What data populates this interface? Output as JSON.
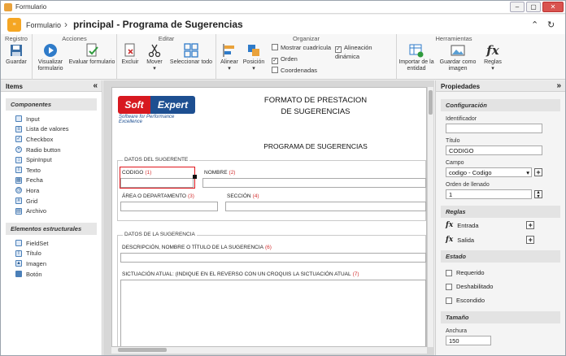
{
  "window": {
    "title": "Formulario"
  },
  "header": {
    "app": "Formulario",
    "separator": "›",
    "page_title": "principal - Programa de Sugerencias"
  },
  "ribbon": {
    "groups": [
      "Registro",
      "Acciones",
      "Editar",
      "Organizar",
      "Herramientas"
    ],
    "buttons": {
      "save": "Guardar",
      "preview": "Visualizar formulario",
      "evaluate": "Evaluar formulario",
      "delete": "Excluir",
      "move": "Mover",
      "select_all": "Seleccionar todo",
      "align": "Alinear",
      "position": "Posición",
      "import": "Importar de la entidad",
      "save_image": "Guardar como imagen",
      "rules": "Reglas"
    },
    "checks": {
      "grid": "Mostrar cuadrícula",
      "order": "Orden",
      "coords": "Coordenadas",
      "dynamic_align": "Alineación dinámica"
    }
  },
  "left_panel": {
    "title": "Items",
    "components_title": "Componentes",
    "components": [
      "Input",
      "Lista de valores",
      "Checkbox",
      "Radio button",
      "SpinInput",
      "Texto",
      "Fecha",
      "Hora",
      "Grid",
      "Archivo"
    ],
    "structural_title": "Elementos estructurales",
    "structural": [
      "FieldSet",
      "Título",
      "Imagen",
      "Botón"
    ]
  },
  "form": {
    "logo_soft": "Soft",
    "logo_expert": "Expert",
    "logo_tagline": "Software for Performance Excellence",
    "title_line1": "FORMATO DE PRESTACION",
    "title_line2": "DE SUGERENCIAS",
    "subtitle": "PROGRAMA DE SUGERENCIAS",
    "fs1_legend": "DATOS DEL SUGERENTE",
    "codigo": "CODIGO",
    "codigo_n": "(1)",
    "nombre": "NOMBRE",
    "nombre_n": "(2)",
    "area": "ÁREA O DEPARTAMENTO",
    "area_n": "(3)",
    "seccion": "SECCIÓN",
    "seccion_n": "(4)",
    "fs2_legend": "DATOS DE LA SUGERENCIA",
    "descripcion": "DESCRIPCIÓN, NOMBRE O TÍTULO DE LA SUGERENCIA",
    "descripcion_n": "(6)",
    "situacion": "SICTUACIÓN ATUAL: (INDIQUE EN EL REVERSO CON UN CROQUIS LA SICTUACIÓN ATUAL",
    "situacion_n": "(7)"
  },
  "right_panel": {
    "title": "Propiedades",
    "config_title": "Configuración",
    "identificador_label": "Identificador",
    "identificador_value": "",
    "titulo_label": "Título",
    "titulo_value": "CODIGO",
    "campo_label": "Campo",
    "campo_value": "codigo - Codigo",
    "orden_label": "Orden de llenado",
    "orden_value": "1",
    "reglas_title": "Reglas",
    "entrada": "Entrada",
    "salida": "Salida",
    "estado_title": "Estado",
    "requerido": "Requerido",
    "deshabilitado": "Deshabilitado",
    "escondido": "Escondido",
    "tamano_title": "Tamaño",
    "anchura_label": "Anchura",
    "anchura_value": "150"
  }
}
